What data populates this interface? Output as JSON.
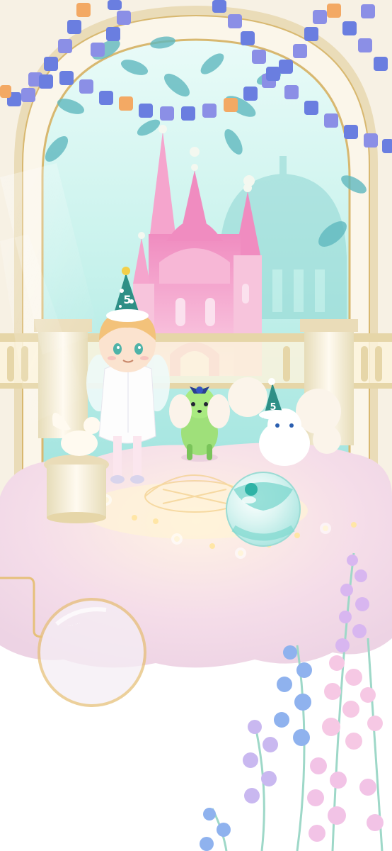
{
  "scene": {
    "name": "birthday-castle-stage-room",
    "lens_caption": "... ..."
  },
  "characters": {
    "avatar_hat_number": "5",
    "pet_hat_number": "5"
  },
  "colors": {
    "sky": "#bff0ec",
    "arch_gold": "#d8b870",
    "castle_pink": "#f6b6d6",
    "cloud_pink": "#f5d7e6",
    "bead_blue": "#6a7ee0",
    "bead_purple": "#8b8fe6",
    "bead_orange": "#f3a964"
  }
}
